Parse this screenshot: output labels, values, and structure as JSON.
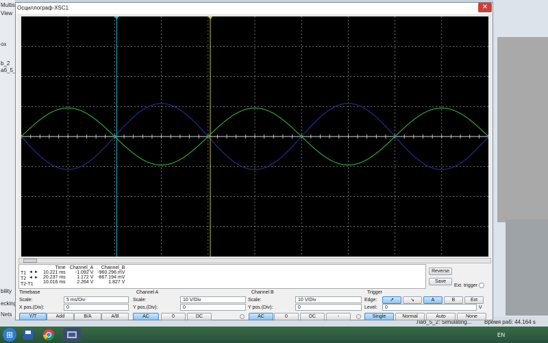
{
  "background_app": {
    "left_labels": [
      "Multis",
      "View",
      "ox",
      "b_2",
      "аб_5_2",
      "bility",
      "ecking",
      "Nets"
    ],
    "status_text": "Лаб_5_2: Simulating...",
    "timer_text": "Время раб: 44.164 s"
  },
  "window": {
    "title": "Осциллограф-XSC1",
    "close_glyph": "✕"
  },
  "colors": {
    "screen_bg": "#000000",
    "grid": "#a0a0a0",
    "channel_a": "#1f2f8c",
    "channel_b": "#33a63a",
    "cursor_t1": "#19b3c2",
    "cursor_t2": "#c8c23a",
    "button_active": "#8fc3ef"
  },
  "chart_data": {
    "type": "line",
    "xlabel": "",
    "ylabel": "",
    "x_unit": "ms",
    "y_unit": "V",
    "xlim": [
      0,
      50
    ],
    "ylim": [
      -4,
      4
    ],
    "grid": true,
    "divisions": {
      "x": 10,
      "y": 8
    },
    "cursors": {
      "T1_ms": 10.221,
      "T2_ms": 20.237
    },
    "series": [
      {
        "channel": "A",
        "color": "#1f2f8c",
        "amplitude_div": 1.1,
        "period_ms": 20,
        "phase_deg": 180,
        "x": [
          0,
          5,
          10,
          15,
          20,
          25,
          30,
          35,
          40,
          45,
          50
        ],
        "y": [
          0,
          -1.1,
          0,
          1.1,
          0,
          -1.1,
          0,
          1.1,
          0,
          -1.1,
          0
        ]
      },
      {
        "channel": "B",
        "color": "#33a63a",
        "amplitude_div": 0.95,
        "period_ms": 20,
        "phase_deg": 0,
        "x": [
          0,
          5,
          10,
          15,
          20,
          25,
          30,
          35,
          40,
          45,
          50
        ],
        "y": [
          0,
          0.95,
          0,
          -0.95,
          0,
          0.95,
          0,
          -0.95,
          0,
          0.95,
          0
        ]
      }
    ]
  },
  "measurements": {
    "headers": [
      "Time",
      "Channel_A",
      "Channel_B"
    ],
    "rows": [
      {
        "label": "T1",
        "time": "10.221 ms",
        "a": "-1.092 V",
        "b": "-960.296 mV"
      },
      {
        "label": "T2",
        "time": "20.237 ms",
        "a": "1.172 V",
        "b": "-867.194 mV"
      },
      {
        "label": "T2-T1",
        "time": "10.016 ms",
        "a": "2.264 V",
        "b": "1.827 V"
      }
    ],
    "arrow_left": "◄",
    "arrow_right": "►"
  },
  "side_buttons": {
    "reverse": "Reverse",
    "save": "Save",
    "ext_trigger": "Ext. trigger"
  },
  "timebase": {
    "title": "Timebase",
    "scale_label": "Scale:",
    "scale_value": "5 ms/Div",
    "xpos_label": "X pos.(Div):",
    "xpos_value": "0",
    "buttons": [
      "Y/T",
      "Add",
      "B/A",
      "A/B"
    ]
  },
  "channel_a": {
    "title": "Channel A",
    "scale_label": "Scale:",
    "scale_value": "10  V/Div",
    "ypos_label": "Y pos.(Div):",
    "ypos_value": "0",
    "buttons": [
      "AC",
      "0",
      "DC"
    ]
  },
  "channel_b": {
    "title": "Channel B",
    "scale_label": "Scale:",
    "scale_value": "10  V/Div",
    "ypos_label": "Y pos.(Div):",
    "ypos_value": "0",
    "buttons": [
      "AC",
      "0",
      "DC",
      "-"
    ]
  },
  "trigger": {
    "title": "Trigger",
    "edge_label": "Edge:",
    "edge_buttons": [
      "↗",
      "↘",
      "A",
      "B",
      "Ext"
    ],
    "level_label": "Level:",
    "level_value": "0",
    "level_unit": "V",
    "mode_buttons": [
      "Single",
      "Normal",
      "Auto",
      "None"
    ]
  },
  "taskbar": {
    "lang": "EN",
    "icons": [
      "start-icon",
      "folder-icon",
      "save-icon",
      "chrome-icon",
      "app-icon"
    ]
  }
}
